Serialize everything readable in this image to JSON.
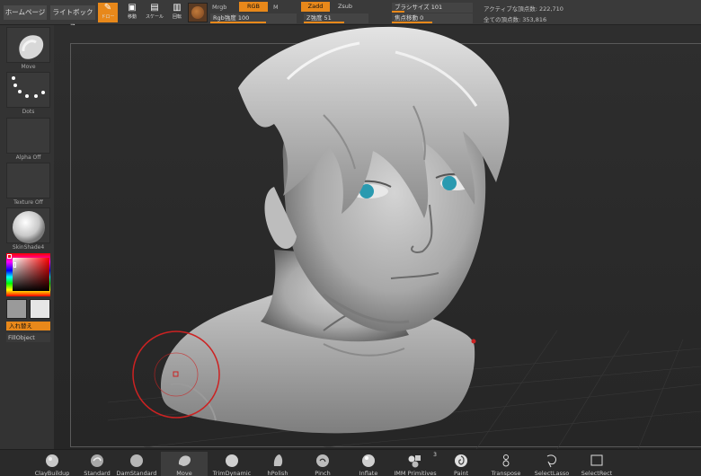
{
  "nav": {
    "home": "ホームページ",
    "lightbox": "ライトボックス"
  },
  "tools": {
    "draw_label": "ドロー",
    "move_label": "移動",
    "scale_label": "スケール",
    "rotate_label": "回転"
  },
  "material": {
    "mrgb": "Mrgb",
    "rgb": "RGB",
    "m": "M",
    "zadd": "Zadd",
    "zsub": "Zsub",
    "rgb_intensity": "Rgb強度 100",
    "z_intensity": "Z強度 51"
  },
  "draw_settings": {
    "brush_size": "ブラシサイズ 101",
    "focal_shift": "焦点移動 0"
  },
  "stats": {
    "active_points": "アクティブな頂点数: 222,710",
    "total_points": "全ての頂点数: 353,816"
  },
  "left_panel": {
    "brush": "Move",
    "stroke": "Dots",
    "alpha": "Alpha Off",
    "texture": "Texture Off",
    "material": "SkinShade4",
    "swap": "入れ替え",
    "fill": "FillObject"
  },
  "brushes": [
    {
      "label": "ClayBuildup",
      "icon": "claybuildup-icon"
    },
    {
      "label": "Standard",
      "icon": "standard-icon"
    },
    {
      "label": "DamStandard",
      "icon": "damstandard-icon"
    },
    {
      "label": "Move",
      "icon": "move-icon"
    },
    {
      "label": "TrimDynamic",
      "icon": "trimdynamic-icon"
    },
    {
      "label": "hPolish",
      "icon": "hpolish-icon"
    },
    {
      "label": "Pinch",
      "icon": "pinch-icon"
    },
    {
      "label": "Inflate",
      "icon": "inflate-icon"
    },
    {
      "label": "IMM Primitives",
      "icon": "imm-primitives-icon",
      "badge": "3"
    },
    {
      "label": "Paint",
      "icon": "paint-icon"
    },
    {
      "label": "Transpose",
      "icon": "transpose-icon"
    },
    {
      "label": "SelectLasso",
      "icon": "selectlasso-icon"
    },
    {
      "label": "SelectRect",
      "icon": "selectrect-icon"
    }
  ],
  "colors": {
    "accent": "#e8881a",
    "cursor": "#cc2222",
    "eye": "#2a9ab0"
  },
  "sliders": {
    "rgb_intensity": 0.65,
    "z_intensity": 0.62,
    "brush_size": 0.16,
    "focal_shift": 0.5
  }
}
